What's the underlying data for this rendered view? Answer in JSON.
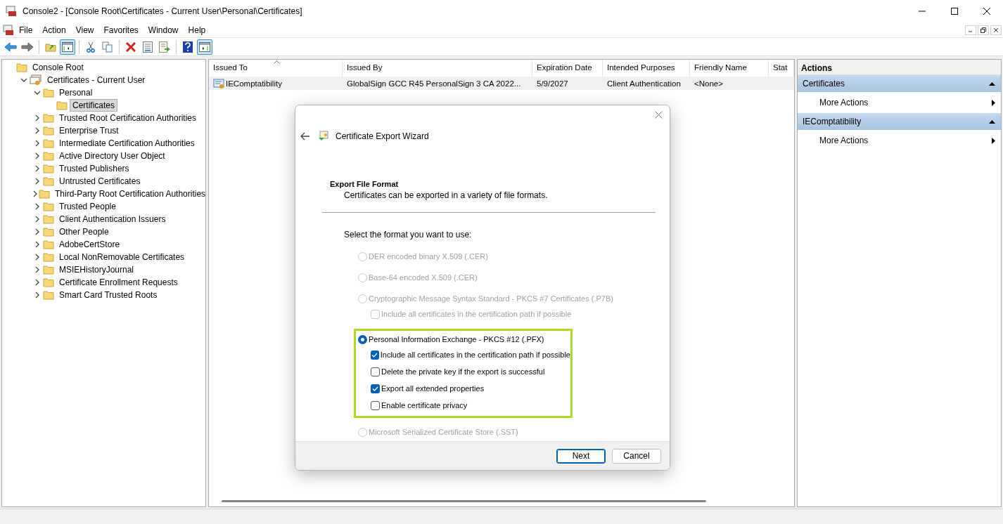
{
  "window": {
    "title": "Console2 - [Console Root\\Certificates - Current User\\Personal\\Certificates]"
  },
  "menu": [
    "File",
    "Action",
    "View",
    "Favorites",
    "Window",
    "Help"
  ],
  "toolbar": [
    {
      "kind": "back",
      "pressed": false
    },
    {
      "kind": "forward",
      "pressed": false
    },
    {
      "kind": "sep"
    },
    {
      "kind": "up",
      "pressed": false
    },
    {
      "kind": "tree",
      "pressed": true
    },
    {
      "kind": "sep"
    },
    {
      "kind": "cut",
      "pressed": false
    },
    {
      "kind": "copy",
      "pressed": false
    },
    {
      "kind": "sep"
    },
    {
      "kind": "delete",
      "pressed": false
    },
    {
      "kind": "properties",
      "pressed": false
    },
    {
      "kind": "export",
      "pressed": false
    },
    {
      "kind": "sep"
    },
    {
      "kind": "help",
      "pressed": false
    },
    {
      "kind": "actionpane",
      "pressed": true
    }
  ],
  "tree": [
    {
      "label": "Console Root",
      "kind": "root",
      "selected": false,
      "children": [
        {
          "label": "Certificates - Current User",
          "kind": "store",
          "expanded": true,
          "selected": false,
          "children": [
            {
              "label": "Personal",
              "kind": "folder",
              "expanded": true,
              "selected": false,
              "children": [
                {
                  "label": "Certificates",
                  "kind": "folder",
                  "selected": true
                }
              ]
            },
            {
              "label": "Trusted Root Certification Authorities",
              "kind": "folder",
              "expanded": false,
              "selected": false
            },
            {
              "label": "Enterprise Trust",
              "kind": "folder",
              "expanded": false,
              "selected": false
            },
            {
              "label": "Intermediate Certification Authorities",
              "kind": "folder",
              "expanded": false,
              "selected": false
            },
            {
              "label": "Active Directory User Object",
              "kind": "folder",
              "expanded": false,
              "selected": false
            },
            {
              "label": "Trusted Publishers",
              "kind": "folder",
              "expanded": false,
              "selected": false
            },
            {
              "label": "Untrusted Certificates",
              "kind": "folder",
              "expanded": false,
              "selected": false
            },
            {
              "label": "Third-Party Root Certification Authorities",
              "kind": "folder",
              "expanded": false,
              "selected": false
            },
            {
              "label": "Trusted People",
              "kind": "folder",
              "expanded": false,
              "selected": false
            },
            {
              "label": "Client Authentication Issuers",
              "kind": "folder",
              "expanded": false,
              "selected": false
            },
            {
              "label": "Other People",
              "kind": "folder",
              "expanded": false,
              "selected": false
            },
            {
              "label": "AdobeCertStore",
              "kind": "folder",
              "expanded": false,
              "selected": false
            },
            {
              "label": "Local NonRemovable Certificates",
              "kind": "folder",
              "expanded": false,
              "selected": false
            },
            {
              "label": "MSIEHistoryJournal",
              "kind": "folder",
              "expanded": false,
              "selected": false
            },
            {
              "label": "Certificate Enrollment Requests",
              "kind": "folder",
              "expanded": false,
              "selected": false
            },
            {
              "label": "Smart Card Trusted Roots",
              "kind": "folder",
              "expanded": false,
              "selected": false
            }
          ]
        }
      ]
    }
  ],
  "table": {
    "columns": [
      {
        "label": "Issued To",
        "sorted": true
      },
      {
        "label": "Issued By"
      },
      {
        "label": "Expiration Date"
      },
      {
        "label": "Intended Purposes"
      },
      {
        "label": "Friendly Name"
      },
      {
        "label": "Stat"
      }
    ],
    "rows": [
      {
        "selected": true,
        "cells": [
          "IEComptatibility",
          "GlobalSign GCC R45 PersonalSign 3 CA 2022...",
          "5/9/2027",
          "Client Authentication",
          "<None>"
        ]
      }
    ]
  },
  "actions": {
    "title": "Actions",
    "sections": [
      {
        "title": "Certificates",
        "items": [
          "More Actions"
        ]
      },
      {
        "title": "IEComptatibility",
        "items": [
          "More Actions"
        ]
      }
    ]
  },
  "dialog": {
    "title": "Certificate Export Wizard",
    "heading": "Export File Format",
    "subtitle": "Certificates can be exported in a variety of file formats.",
    "prompt": "Select the format you want to use:",
    "options": [
      {
        "label": "DER encoded binary X.509 (.CER)",
        "selected": false,
        "disabled": true,
        "highlighted": false
      },
      {
        "label": "Base-64 encoded X.509 (.CER)",
        "selected": false,
        "disabled": true,
        "highlighted": false
      },
      {
        "label": "Cryptographic Message Syntax Standard - PKCS #7 Certificates (.P7B)",
        "selected": false,
        "disabled": true,
        "highlighted": false,
        "checks": [
          {
            "label": "Include all certificates in the certification path if possible",
            "checked": false,
            "disabled": true
          }
        ]
      },
      {
        "label": "Personal Information Exchange - PKCS #12 (.PFX)",
        "selected": true,
        "disabled": false,
        "highlighted": true,
        "checks": [
          {
            "label": "Include all certificates in the certification path if possible",
            "checked": true,
            "disabled": false
          },
          {
            "label": "Delete the private key if the export is successful",
            "checked": false,
            "disabled": false
          },
          {
            "label": "Export all extended properties",
            "checked": true,
            "disabled": false
          },
          {
            "label": "Enable certificate privacy",
            "checked": false,
            "disabled": false
          }
        ]
      },
      {
        "label": "Microsoft Serialized Certificate Store (.SST)",
        "selected": false,
        "disabled": true,
        "highlighted": false
      }
    ],
    "buttons": [
      {
        "label": "Next",
        "default": true
      },
      {
        "label": "Cancel",
        "default": false
      }
    ]
  }
}
